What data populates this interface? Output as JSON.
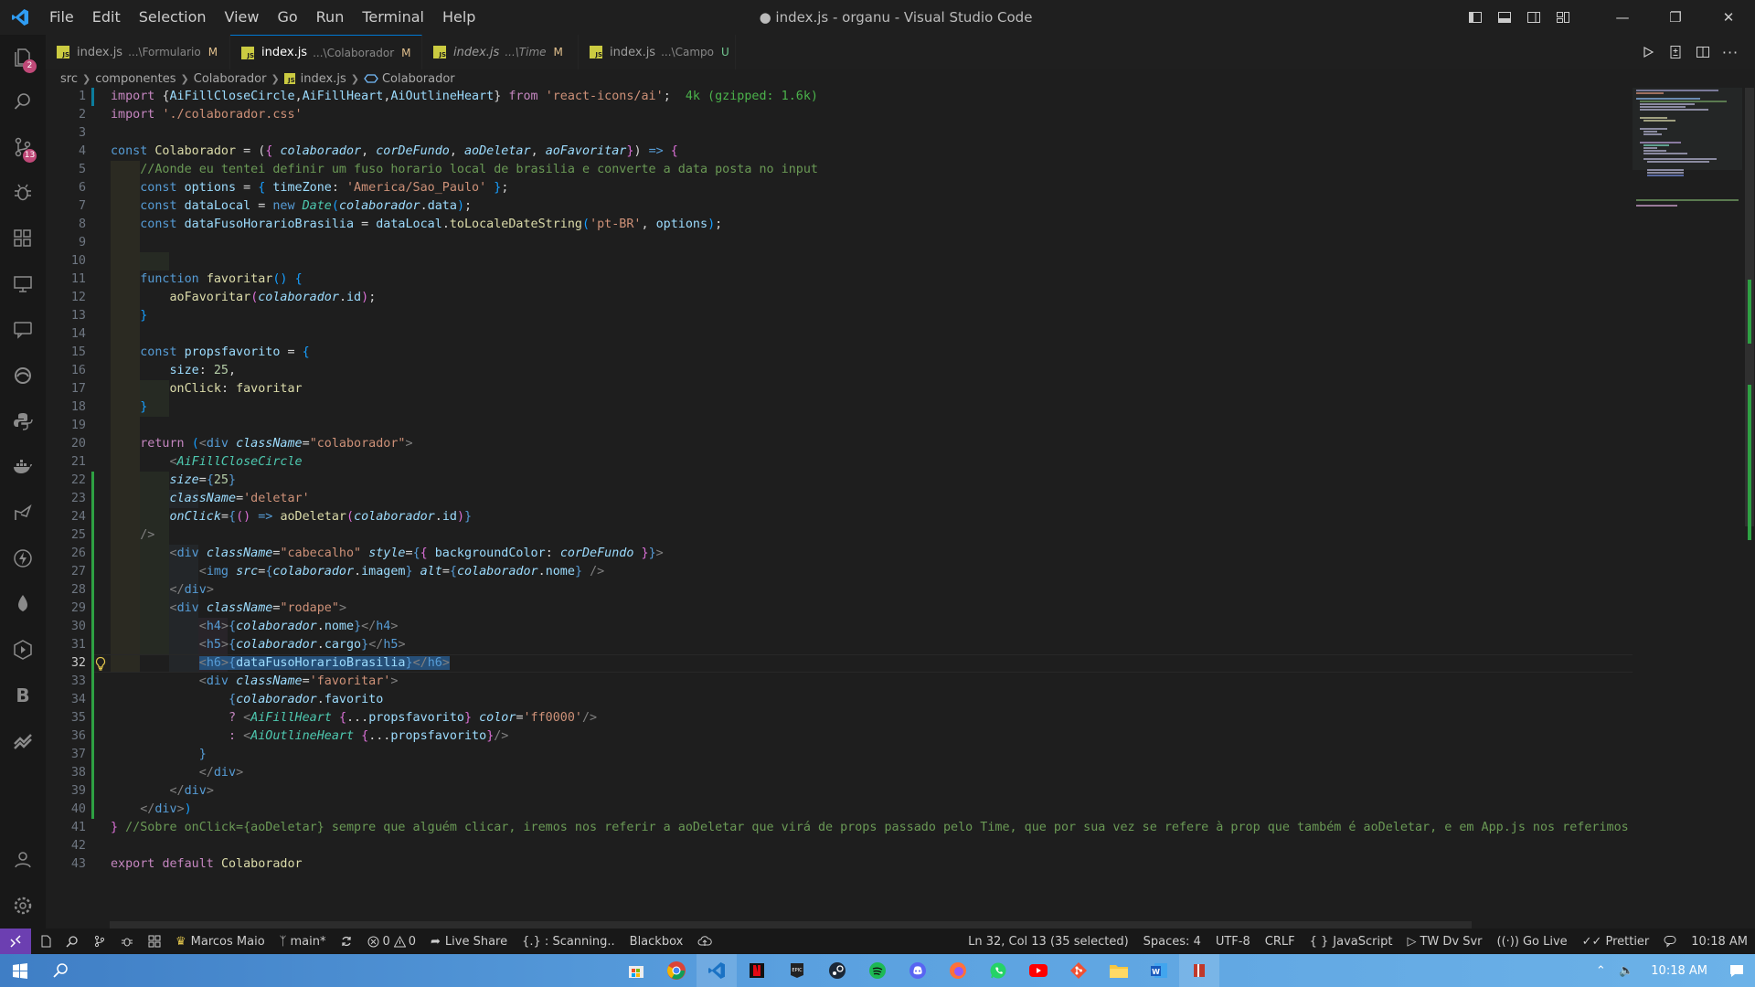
{
  "window": {
    "title": "● index.js - organu - Visual Studio Code"
  },
  "menu": [
    "File",
    "Edit",
    "Selection",
    "View",
    "Go",
    "Run",
    "Terminal",
    "Help"
  ],
  "activity": {
    "explorer_badge": "2",
    "scm_badge": "13"
  },
  "tabs": [
    {
      "name": "index.js",
      "path": "...\\Formulario",
      "status": "M"
    },
    {
      "name": "index.js",
      "path": "...\\Colaborador",
      "status": "M"
    },
    {
      "name": "index.js",
      "path": "...\\Time",
      "status": "M"
    },
    {
      "name": "index.js",
      "path": "...\\Campo",
      "status": "U"
    }
  ],
  "breadcrumb": [
    "src",
    "componentes",
    "Colaborador",
    "index.js",
    "Colaborador"
  ],
  "editor": {
    "line_numbers": [
      "1",
      "2",
      "3",
      "4",
      "5",
      "6",
      "7",
      "8",
      "9",
      "10",
      "11",
      "12",
      "13",
      "14",
      "15",
      "16",
      "17",
      "18",
      "19",
      "20",
      "21",
      "22",
      "23",
      "24",
      "25",
      "26",
      "27",
      "28",
      "29",
      "30",
      "31",
      "32",
      "33",
      "34",
      "35",
      "36",
      "37",
      "38",
      "39",
      "40",
      "41",
      "42",
      "43"
    ],
    "import_size_hint": "4k (gzipped: 1.6k)",
    "comment_line5": "//Aonde eu tentei definir um fuso horario local de brasilia e converte a data posta no input",
    "comment_line41": "//Sobre onClick={aoDeletar} sempre que alguém clicar, iremos nos referir a aoDeletar que virá de props passado pelo Time, que por sua vez se refere à prop que também é aoDeletar, e em App.js nos referimos a"
  },
  "status": {
    "account": "Marcos Maio",
    "branch": "main*",
    "errors": "0",
    "warnings": "0",
    "live_share": "Live Share",
    "scanning": "{.} : Scanning..",
    "blackbox": "Blackbox",
    "cursor": "Ln 32, Col 13 (35 selected)",
    "spaces": "Spaces: 4",
    "encoding": "UTF-8",
    "eol": "CRLF",
    "language": "JavaScript",
    "tw": "TW Dv Svr",
    "golive": "Go Live",
    "prettier": "Prettier",
    "time": "10:18 AM"
  },
  "taskbar": {
    "time": "10:18 AM",
    "apps": [
      "windows-store",
      "chrome",
      "vscode",
      "netflix",
      "epic-games",
      "steam",
      "spotify",
      "discord",
      "firefox",
      "whatsapp",
      "youtube",
      "git",
      "file-explorer",
      "word",
      "flag-app"
    ]
  }
}
